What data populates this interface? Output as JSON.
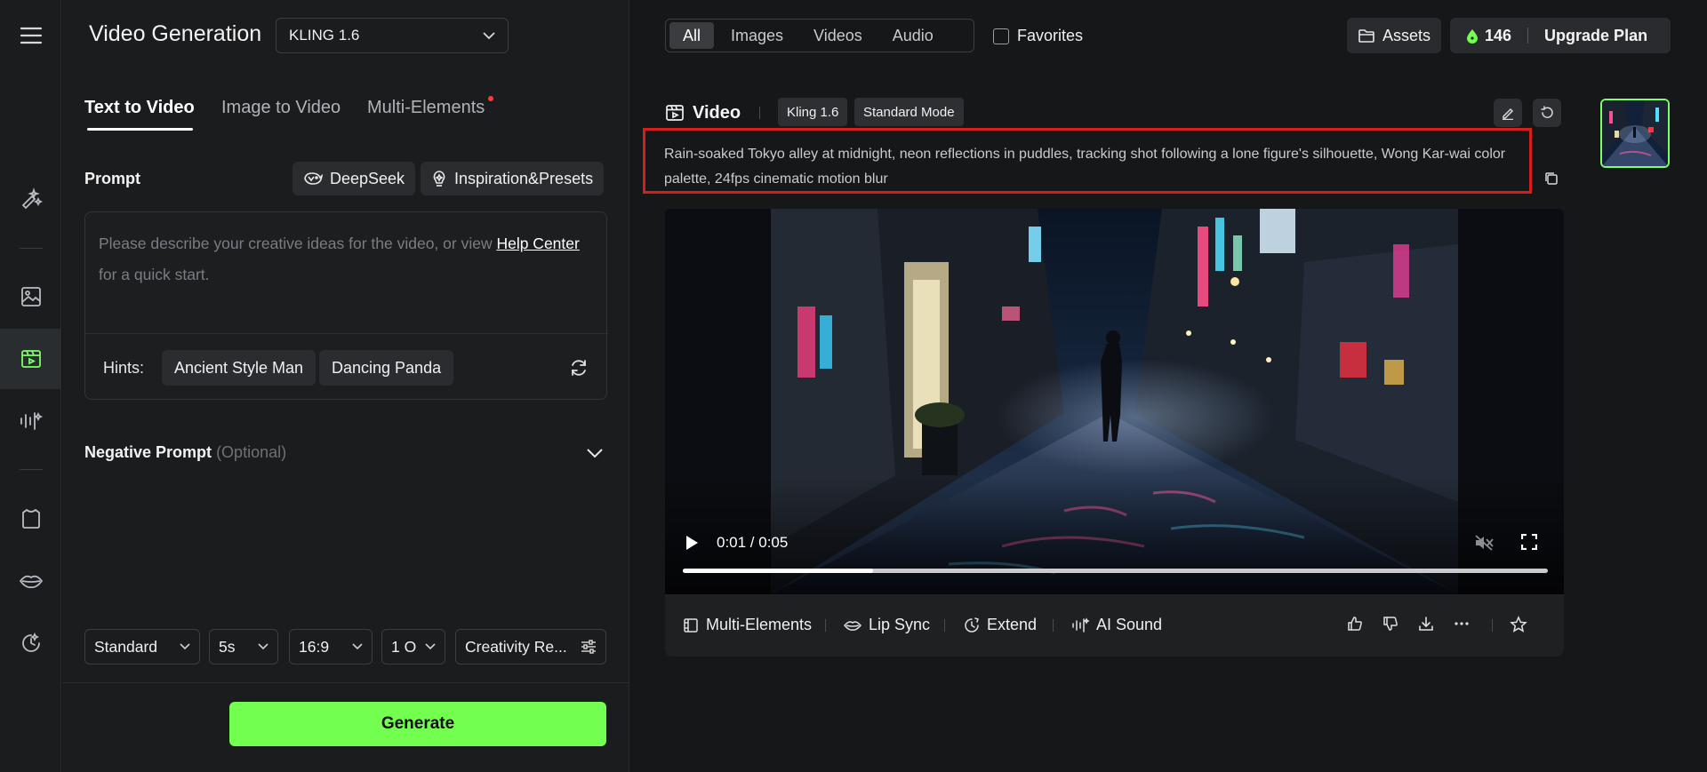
{
  "panel": {
    "title": "Video Generation",
    "model": "KLING 1.6",
    "tabs": [
      {
        "label": "Text to Video"
      },
      {
        "label": "Image to Video"
      },
      {
        "label": "Multi-Elements"
      }
    ],
    "prompt_label": "Prompt",
    "deepseek_label": "DeepSeek",
    "inspiration_label": "Inspiration&Presets",
    "prompt_placeholder_before": "Please describe your creative ideas for the video, or view ",
    "help_center": "Help Center",
    "prompt_placeholder_after": " for a quick start.",
    "hints_label": "Hints:",
    "hints": [
      "Ancient Style Man",
      "Dancing Panda"
    ],
    "negative_label": "Negative Prompt",
    "negative_optional": "(Optional)",
    "params": {
      "mode": "Standard",
      "duration": "5s",
      "ratio": "16:9",
      "count": "1 O",
      "creativity": "Creativity Re..."
    },
    "generate": "Generate"
  },
  "main": {
    "filters": [
      "All",
      "Images",
      "Videos",
      "Audio"
    ],
    "favorites": "Favorites",
    "assets": "Assets",
    "credits": "146",
    "upgrade": "Upgrade Plan",
    "video_label": "Video",
    "model_chip": "Kling 1.6",
    "mode_chip": "Standard Mode",
    "prompt_line1": "Rain-soaked Tokyo alley at midnight, neon reflections in puddles, tracking shot following a lone figure's silhouette, Wong Kar-wai color",
    "prompt_line2": "palette, 24fps cinematic motion blur",
    "player_time": "0:01 / 0:05",
    "player_progress": 0.22,
    "actions": {
      "multi": "Multi-Elements",
      "lip": "Lip Sync",
      "extend": "Extend",
      "sound": "AI Sound"
    }
  },
  "colors": {
    "accent": "#72ff4f",
    "highlight": "#d71d1d",
    "tab_dot": "#ff3b3b"
  }
}
